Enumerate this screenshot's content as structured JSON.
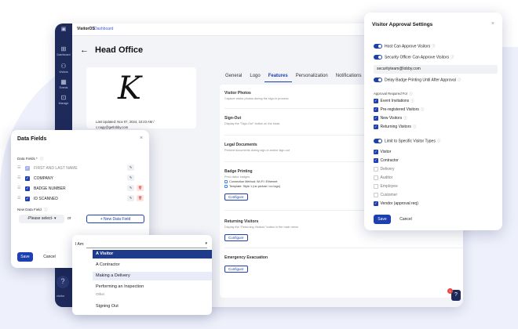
{
  "app": {
    "brand": "VisitorOS",
    "breadcrumb": "Dashboard",
    "page_title": "Head Office",
    "back_arrow": "←",
    "sidebar": [
      {
        "icon": "⊞",
        "label": "Dashboard"
      },
      {
        "icon": "⚇",
        "label": "Visitors"
      },
      {
        "icon": "▦",
        "label": "Events"
      },
      {
        "icon": "⊡",
        "label": "Manage"
      }
    ],
    "help_glyph": "?",
    "powered_by": "visitor",
    "chat_glyph": "?",
    "chat_badge": "1"
  },
  "logo_card": {
    "glyph": "K",
    "last_updated": "Last Updated:  Nov 07, 2024, 10:23 AM  /",
    "email": "c.nagy@getlobby.com"
  },
  "tabs": [
    "General",
    "Logo",
    "Features",
    "Personalization",
    "Notifications"
  ],
  "features": {
    "visitor_photos": {
      "title": "Visitor Photos",
      "desc": "Capture visitor photos during the sign-in process"
    },
    "sign_out": {
      "title": "Sign-Out",
      "desc": "Display the \"Sign-Out\" button on the kiosk"
    },
    "legal": {
      "title": "Legal Documents",
      "desc": "Present documents during sign-in and/or sign-out"
    },
    "badge": {
      "title": "Badge Printing",
      "desc": "Print visitor badges",
      "conn": "Connection Method: Wi-Fi / Ethernet",
      "template": "Template: Style 1 (no picture / no logo)",
      "configure": "Configure"
    },
    "returning": {
      "title": "Returning Visitors",
      "desc": "Display the \"Returning Visitors\" button in the main menu",
      "configure": "Configure"
    },
    "emergency": {
      "title": "Emergency Evacuation",
      "configure": "Configure"
    }
  },
  "data_fields": {
    "title": "Data Fields",
    "close": "×",
    "label": "Data Fields *",
    "info": "ⓘ",
    "fields": [
      {
        "name": "FIRST AND LAST NAME",
        "disabled": true,
        "deletable": false
      },
      {
        "name": "COMPANY",
        "disabled": false,
        "deletable": false
      },
      {
        "name": "BADGE NUMBER",
        "disabled": false,
        "deletable": true
      },
      {
        "name": "ID SCANNED",
        "disabled": false,
        "deletable": true
      }
    ],
    "new_label": "New Data Field",
    "select_placeholder": "-Please select-",
    "select_caret": "▾",
    "or": "or",
    "add_button": "+ New Data Field",
    "save": "Save",
    "cancel": "Cancel"
  },
  "iam_dropdown": {
    "label": "I Am:",
    "caret": "▾",
    "options": [
      {
        "text": "A Visitor",
        "state": "selected"
      },
      {
        "text": "A Contractor",
        "state": ""
      },
      {
        "text": "Making a Delivery",
        "state": "highlight"
      },
      {
        "text": "Performing an Inspection",
        "state": ""
      },
      {
        "text": "Other",
        "state": ""
      },
      {
        "text": "Signing Out",
        "state": ""
      }
    ]
  },
  "approval": {
    "title": "Visitor Approval Settings",
    "close": "×",
    "toggles": [
      "Host Can Approve Visitors",
      "Security Officer Can Approve Visitors"
    ],
    "email": "securityteam@lobby.com",
    "delay_toggle": "Delay Badge Printing Until After Approval",
    "required_for_label": "Approval Required For",
    "required_for": [
      {
        "label": "Event Invitations",
        "checked": true
      },
      {
        "label": "Pre-registered Visitors",
        "checked": true
      },
      {
        "label": "New Visitors",
        "checked": true
      },
      {
        "label": "Returning Visitors",
        "checked": true
      }
    ],
    "limit_toggle": "Limit to Specific Visitor Types",
    "visitor_types": [
      {
        "label": "Visitor",
        "checked": true
      },
      {
        "label": "Contractor",
        "checked": true
      },
      {
        "label": "Delivery",
        "checked": false
      },
      {
        "label": "Auditor",
        "checked": false
      },
      {
        "label": "Employee",
        "checked": false
      },
      {
        "label": "Customer",
        "checked": false
      },
      {
        "label": "Vendor (approval req)",
        "checked": true
      }
    ],
    "save": "Save",
    "cancel": "Cancel"
  }
}
